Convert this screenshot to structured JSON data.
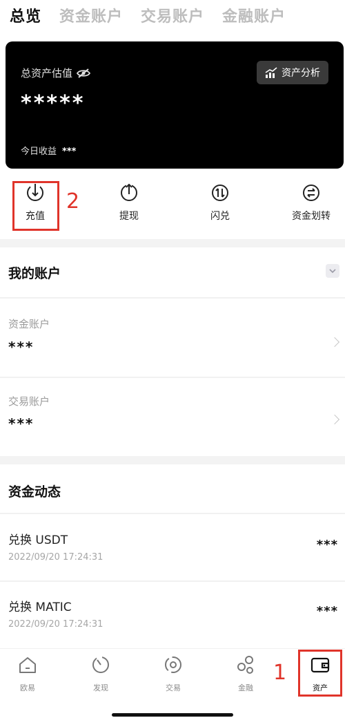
{
  "tabs": [
    "总览",
    "资金账户",
    "交易账户",
    "金融账户"
  ],
  "card": {
    "label": "总资产估值",
    "value": "*****",
    "today_label": "今日收益",
    "today_value": "***",
    "analysis_label": "资产分析"
  },
  "actions": [
    {
      "label": "充值",
      "icon": "deposit-icon"
    },
    {
      "label": "提现",
      "icon": "withdraw-icon"
    },
    {
      "label": "闪兑",
      "icon": "swap-icon"
    },
    {
      "label": "资金划转",
      "icon": "transfer-icon"
    }
  ],
  "annotations": {
    "n1": "1",
    "n2": "2"
  },
  "accounts_section": {
    "title": "我的账户",
    "items": [
      {
        "label": "资金账户",
        "value": "***"
      },
      {
        "label": "交易账户",
        "value": "***"
      }
    ]
  },
  "activity_section": {
    "title": "资金动态",
    "items": [
      {
        "title": "兑换 USDT",
        "time": "2022/09/20 17:24:31",
        "amount": "***"
      },
      {
        "title": "兑换 MATIC",
        "time": "2022/09/20 17:24:31",
        "amount": "***"
      }
    ]
  },
  "nav": [
    {
      "label": "欧易",
      "icon": "home-icon"
    },
    {
      "label": "发现",
      "icon": "discover-icon"
    },
    {
      "label": "交易",
      "icon": "trade-icon"
    },
    {
      "label": "金融",
      "icon": "finance-icon"
    },
    {
      "label": "资产",
      "icon": "wallet-icon"
    }
  ],
  "colors": {
    "accent_red": "#e0342a",
    "card_bg": "#000000"
  }
}
